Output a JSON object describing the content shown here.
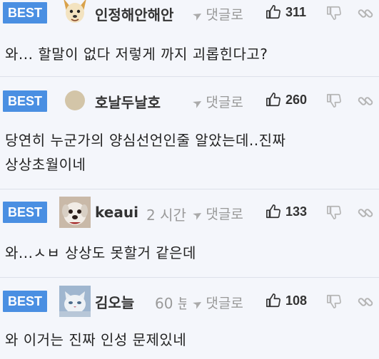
{
  "colors": {
    "badge": "#4a8fe2",
    "background": "#f4f6fb",
    "muted": "#999999"
  },
  "comments": [
    {
      "badge": "BEST",
      "avatar": "dog-cartoon-avatar",
      "nickname": "인정해안해안",
      "time": "",
      "reply_label": "댓글로",
      "likes": "311",
      "text": "와... 할말이 없다 저렇게 까지 괴롭힌다고?"
    },
    {
      "badge": "BEST",
      "avatar": "default-circle-avatar",
      "nickname": "호날두날호",
      "time": "",
      "reply_label": "댓글로",
      "likes": "260",
      "text": "당연히 누군가의 양심선언인줄 알았는데..진짜\n상상초월이네"
    },
    {
      "badge": "BEST",
      "avatar": "puppy-photo-avatar",
      "nickname": "keaui",
      "time": "2 시간",
      "reply_label": "댓글로",
      "likes": "133",
      "text": "와...ㅅㅂ 상상도 못할거 같은데"
    },
    {
      "badge": "BEST",
      "avatar": "cat-photo-avatar",
      "nickname": "김오늘",
      "time": "60 분",
      "reply_label": "댓글로",
      "likes": "108",
      "text": "와 이거는 진짜 인성 문제있네"
    }
  ]
}
